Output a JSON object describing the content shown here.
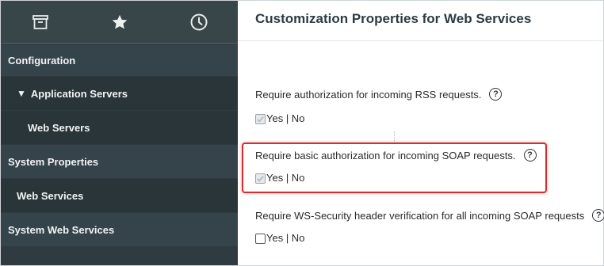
{
  "sidebar": {
    "icons": [
      {
        "name": "archive-icon"
      },
      {
        "name": "star-icon"
      },
      {
        "name": "clock-icon"
      }
    ],
    "items": [
      {
        "label": "Configuration",
        "level": 0
      },
      {
        "label": "Application Servers",
        "level": 1,
        "expanded": true
      },
      {
        "label": "Web Servers",
        "level": 2
      },
      {
        "label": "System Properties",
        "level": 0
      },
      {
        "label": "Web Services",
        "level": 1
      },
      {
        "label": "System Web Services",
        "level": 0
      }
    ]
  },
  "main": {
    "title": "Customization Properties for Web Services",
    "properties": [
      {
        "label": "Require authorization for incoming RSS requests.",
        "help": "?",
        "choice": "Yes | No",
        "checked": true
      },
      {
        "label": "Require basic authorization for incoming SOAP requests.",
        "help": "?",
        "choice": "Yes | No",
        "checked": true,
        "highlighted": true
      },
      {
        "label": "Require WS-Security header verification for all incoming SOAP requests",
        "help": "?",
        "choice": "Yes | No",
        "checked": false
      }
    ]
  },
  "colors": {
    "sidebar_bg": "#2f3b40",
    "highlight": "#d92b2b"
  }
}
